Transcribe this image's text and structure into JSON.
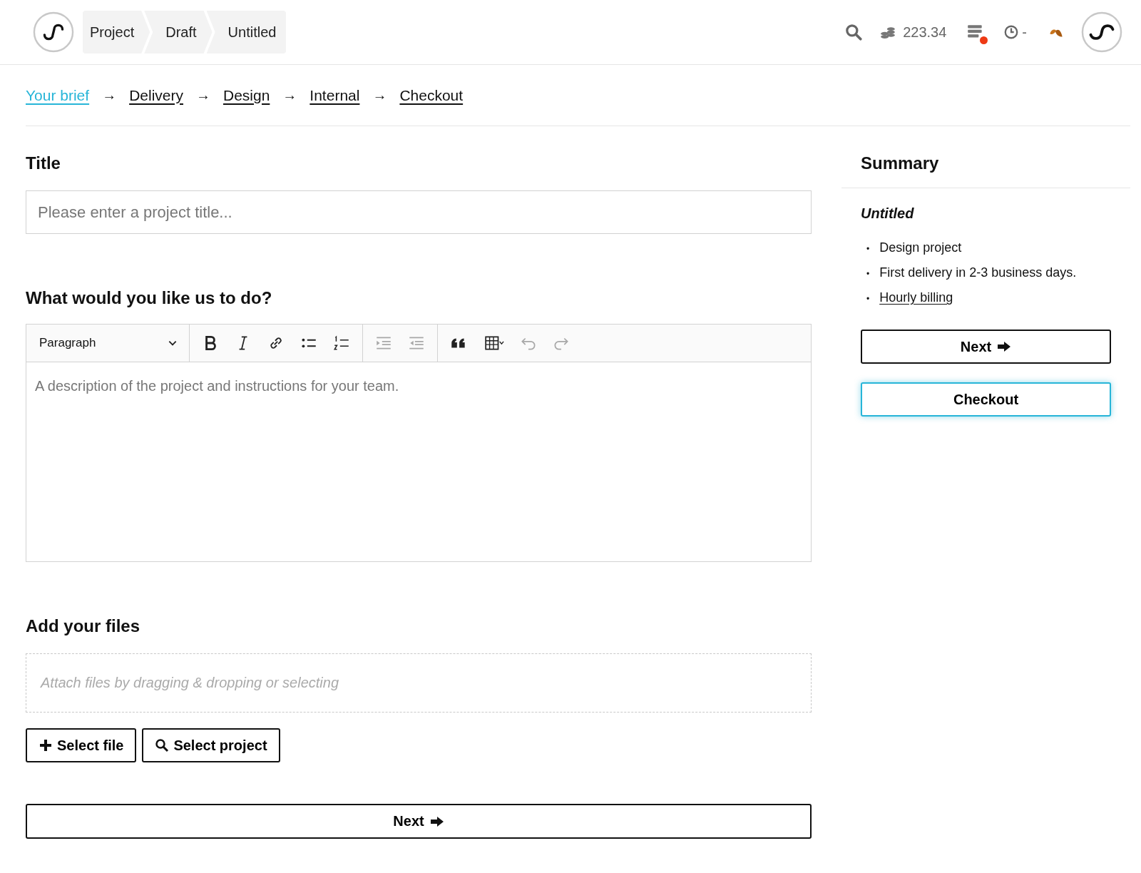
{
  "header": {
    "breadcrumbs": [
      {
        "label": "Project"
      },
      {
        "label": "Draft"
      },
      {
        "label": "Untitled"
      }
    ],
    "credits": "223.34",
    "notifications_alert": true,
    "timer": "-"
  },
  "steps": [
    {
      "label": "Your brief",
      "selected": true
    },
    {
      "label": "Delivery",
      "selected": false,
      "arrow_before": "→"
    },
    {
      "label": "Design",
      "selected": false,
      "arrow_before": "→"
    },
    {
      "label": "Internal",
      "selected": false,
      "arrow_before": "→"
    },
    {
      "label": "Checkout",
      "selected": false,
      "arrow_before": "→"
    }
  ],
  "title_section": {
    "heading": "Title",
    "placeholder": "Please enter a project title..."
  },
  "description_section": {
    "heading": "What would you like us to do?",
    "format_select": "Paragraph",
    "tools": [
      {
        "kind": "bold",
        "disabled": false
      },
      {
        "kind": "italic",
        "disabled": false
      },
      {
        "kind": "link",
        "disabled": false
      },
      {
        "kind": "bullet-list",
        "disabled": false
      },
      {
        "kind": "numbered-list",
        "disabled": false
      },
      {
        "kind": "indent",
        "disabled": true
      },
      {
        "kind": "outdent",
        "disabled": true
      },
      {
        "kind": "quote",
        "disabled": false
      },
      {
        "kind": "table",
        "disabled": false
      },
      {
        "kind": "undo",
        "disabled": true
      },
      {
        "kind": "redo",
        "disabled": true
      }
    ],
    "placeholder": "A description of the project and instructions for your team."
  },
  "files_section": {
    "heading": "Add your files",
    "dropzone_placeholder": "Attach files by dragging & dropping or selecting",
    "buttons": [
      {
        "kind": "plus",
        "label": "Select file"
      },
      {
        "kind": "search",
        "label": "Select project"
      }
    ]
  },
  "next_button": {
    "label": "Next"
  },
  "summary": {
    "heading": "Summary",
    "project_title": "Untitled",
    "items": [
      {
        "kind": "text",
        "bullet": "•",
        "label": "Design project"
      },
      {
        "kind": "text",
        "bullet": "•",
        "label": "First delivery in 2-3 business days."
      },
      {
        "kind": "link",
        "bullet": "•",
        "label": "Hourly billing"
      }
    ],
    "buttons": [
      {
        "kind": "next",
        "label": "Next",
        "focused": false
      },
      {
        "kind": "checkout",
        "label": "Checkout",
        "focused": true
      }
    ]
  }
}
